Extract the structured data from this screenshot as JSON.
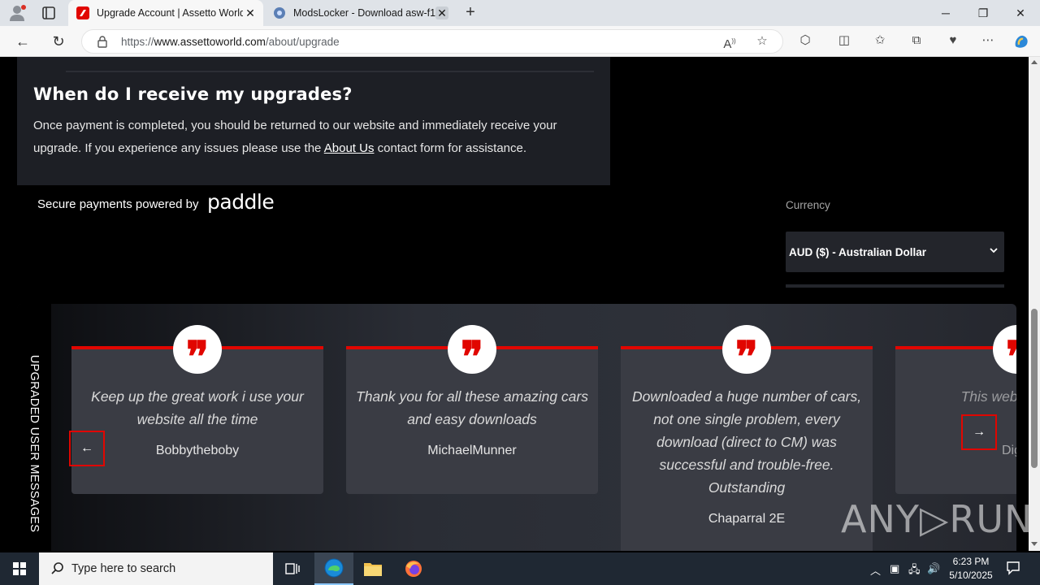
{
  "browser": {
    "tabs": [
      {
        "title": "Upgrade Account | Assetto World",
        "active": true
      },
      {
        "title": "ModsLocker - Download asw-f1-",
        "active": false
      }
    ],
    "new_tab_label": "+",
    "window_controls": {
      "minimize": "─",
      "restore": "❐",
      "close": "✕"
    },
    "url": {
      "prefix": "https://",
      "host": "www.assettoworld.com",
      "path": "/about/upgrade"
    }
  },
  "faq": {
    "question": "When do I receive my upgrades?",
    "answer_before": "Once payment is completed, you should be returned to our website and immediately receive your upgrade. If you experience any issues please use the ",
    "answer_link": "About Us",
    "answer_after": " contact form for assistance."
  },
  "payment": {
    "secure_text": "Secure payments powered by",
    "provider_logo": "paddle",
    "currency_label": "Currency",
    "currency_selected": "AUD ($) - Australian Dollar"
  },
  "testimonials": {
    "section_label": "UPGRADED USER MESSAGES",
    "prev_label": "←",
    "next_label": "→",
    "quote_glyph": "❞",
    "items": [
      {
        "text": "Keep up the great work i use your website all the time",
        "author": "Bobbytheboby"
      },
      {
        "text": "Thank you for all these amazing cars and easy downloads",
        "author": "MichaelMunner"
      },
      {
        "text": "Downloaded a huge number of cars, not one single problem, every download (direct to CM) was successful and trouble-free. Outstanding",
        "author": "Chaparral 2E"
      },
      {
        "text": "This website is real",
        "author": "DigiDe"
      }
    ]
  },
  "watermark": "ANY▷RUN",
  "taskbar": {
    "search_placeholder": "Type here to search",
    "time": "6:23 PM",
    "date": "5/10/2025"
  },
  "colors": {
    "accent_red": "#e10600",
    "panel": "#1d1f25",
    "card": "#3a3c44"
  }
}
